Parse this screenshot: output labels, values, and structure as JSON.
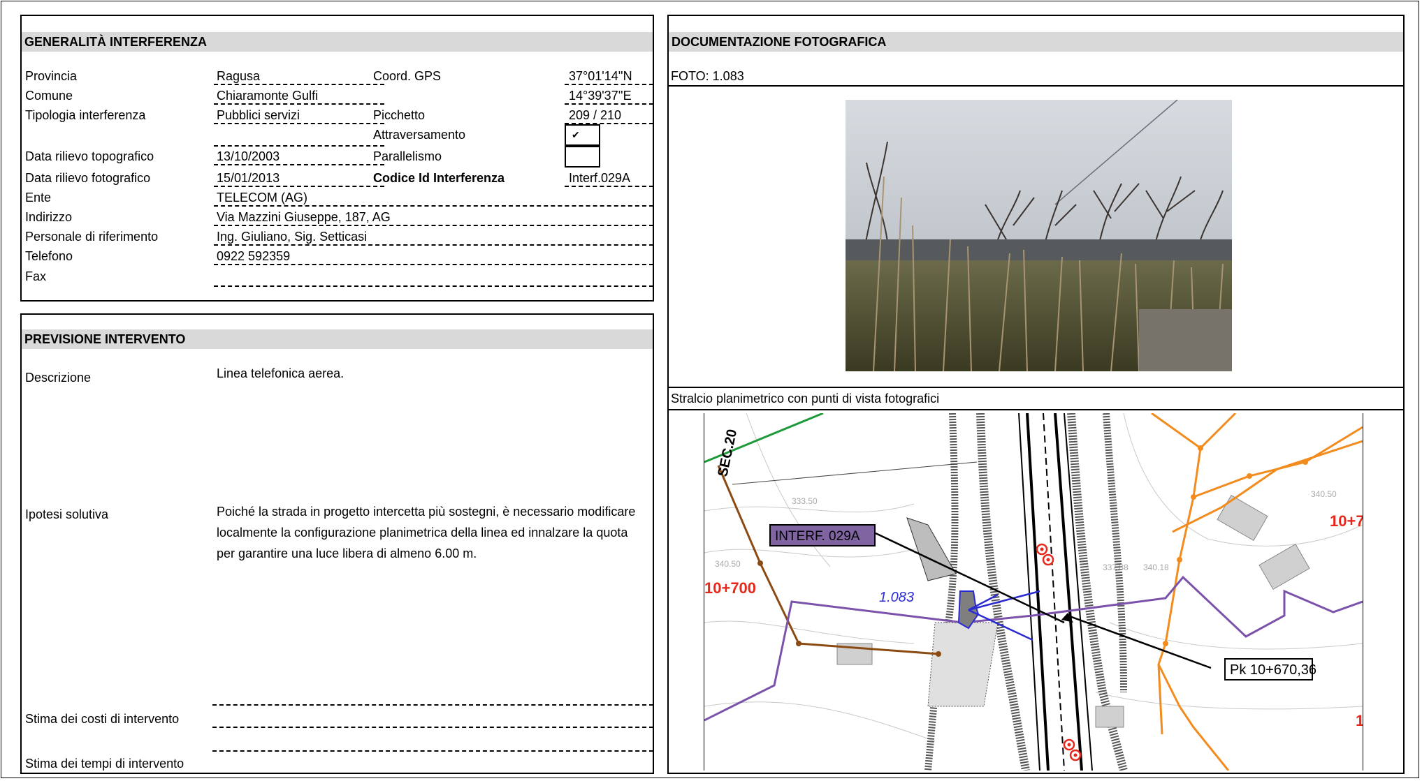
{
  "generalita": {
    "title": "GENERALITÀ  INTERFERENZA",
    "provincia_label": "Provincia",
    "provincia_value": "Ragusa",
    "coord_label": "Coord. GPS",
    "coord_n": "37°01'14''N",
    "coord_e": "14°39'37''E",
    "comune_label": "Comune",
    "comune_value": "Chiaramonte Gulfi",
    "tipologia_label": "Tipologia interferenza",
    "tipologia_value": "Pubblici servizi",
    "picchetto_label": "Picchetto",
    "picchetto_value": "209 / 210",
    "attraversamento_label": "Attraversamento",
    "attraversamento_mark": "✔",
    "rilievo_topo_label": "Data rilievo topografico",
    "rilievo_topo_value": "13/10/2003",
    "parallelismo_label": "Parallelismo",
    "parallelismo_mark": "",
    "rilievo_foto_label": "Data rilievo fotografico",
    "rilievo_foto_value": "15/01/2013",
    "codice_label": "Codice Id Interferenza",
    "codice_value": "Interf.029A",
    "ente_label": "Ente",
    "ente_value": "TELECOM (AG)",
    "indirizzo_label": "Indirizzo",
    "indirizzo_value": "Via Mazzini Giuseppe, 187, AG",
    "personale_label": "Personale di riferimento",
    "personale_value": "Ing. Giuliano, Sig. Setticasi",
    "telefono_label": "Telefono",
    "telefono_value": "0922 592359",
    "fax_label": "Fax",
    "fax_value": ""
  },
  "previsione": {
    "title": "PREVISIONE INTERVENTO",
    "descrizione_label": "Descrizione",
    "descrizione_value": "Linea telefonica aerea.",
    "ipotesi_label": "Ipotesi solutiva",
    "ipotesi_value": "Poiché la strada in progetto intercetta più sostegni, è necessario modificare localmente la configurazione planimetrica della linea ed innalzare la quota per garantire una luce libera di almeno  6.00 m.",
    "costi_label": "Stima dei costi di intervento",
    "costi_value": "",
    "tempi_label": "Stima dei tempi di intervento",
    "tempi_value": ""
  },
  "documentazione": {
    "title": "DOCUMENTAZIONE FOTOGRAFICA",
    "foto_label": "FOTO: 1.083",
    "stralcio_label": "Stralcio planimetrico con punti di vista fotografici"
  },
  "map": {
    "sec_label": "SEC.20",
    "interf_label": "INTERF. 029A",
    "pk_label": "Pk 10+670,36",
    "progressive_left": "10+700",
    "progressive_right": "10+7",
    "progressive_right_bottom": "1",
    "photo_point_label": "1.083",
    "elev_1": "333.50",
    "elev_2": "340.50",
    "elev_3": "340.50",
    "elev_4": "337.88",
    "elev_5": "340.18"
  },
  "colors": {
    "header_bg": "#d9d9d9",
    "telephone_line": "#7b52ab",
    "interf_box": "#8064a2",
    "orange_line": "#f28c1e",
    "brown_line": "#8b4a12",
    "green_line": "#1f9a3a",
    "progressive_red": "#e8271c",
    "photo_label_blue": "#2b2bd4"
  }
}
